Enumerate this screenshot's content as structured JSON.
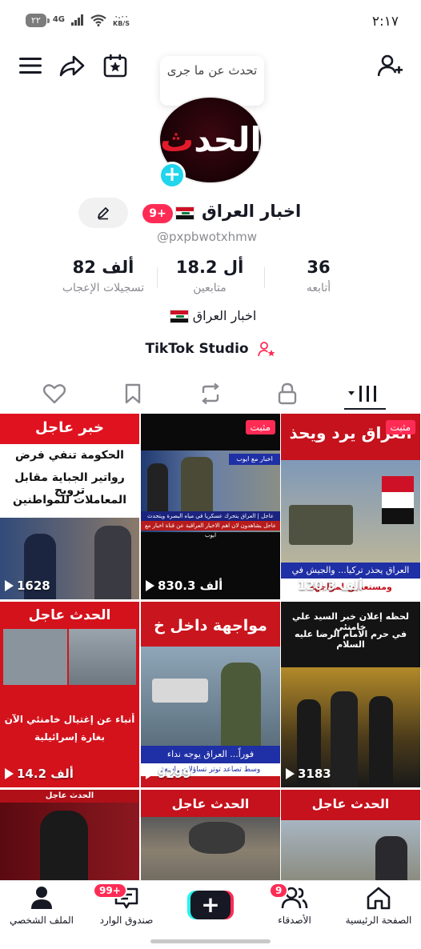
{
  "status_bar": {
    "time": "٢:١٧",
    "battery": "٢٢",
    "network": "4G",
    "speed_value": "٠.٠٠",
    "speed_unit": "KB/S"
  },
  "top_bar": {
    "tooltip": "تحدث عن ما جرى",
    "icons": [
      "menu-icon",
      "share-icon",
      "calendar-star-icon",
      "add-friend-icon"
    ]
  },
  "profile": {
    "avatar_logo_prefix": "الحد",
    "avatar_logo_suffix": "ث",
    "display_name": "اخبار العراق",
    "handle": "@pxpbwotxhmw",
    "badge": "9+",
    "edit_icon": "pencil-icon",
    "stats": [
      {
        "value": "36",
        "label": "أتابعه"
      },
      {
        "value": "18.2 أل",
        "label": "متابعين"
      },
      {
        "value": "82 ألف",
        "label": "تسجيلات الإعجاب"
      }
    ],
    "bio": "اخبار العراق",
    "studio": "TikTok Studio"
  },
  "tabs": [
    {
      "name": "videos",
      "icon": "grid-icon",
      "active": true
    },
    {
      "name": "private",
      "icon": "lock-icon",
      "active": false
    },
    {
      "name": "reposts",
      "icon": "repost-icon",
      "active": false
    },
    {
      "name": "favorites",
      "icon": "bookmark-icon",
      "active": false
    },
    {
      "name": "liked",
      "icon": "heart-icon",
      "active": false
    }
  ],
  "videos": [
    {
      "views": "120.3 ألف",
      "pinned": "مثبت",
      "headline": "العراق يرد ويحذ",
      "caption": "العراق يحذر تركيا... والجيش في",
      "subcaption": "ومستعدين لمواجهة"
    },
    {
      "views": "830.3 ألف",
      "pinned": "مثبت",
      "ticker_top": "اخبار مع ايوب",
      "ticker1": "عاجل | العراق يتحرك عسكريا في مياه البصرة ويتحدث الكويتية",
      "ticker2": "عاجل يشاهدون لان اهم الاخبار العراقية عن قناة اخبار مع ايوب"
    },
    {
      "views": "1628",
      "banner": "خبر عاجل",
      "caption": "الحكومة تنفي فرض",
      "caption2": "رواتير الجباية مقابل ترويج",
      "caption3": "المعاملات للمواطنين"
    },
    {
      "views": "3183",
      "caption": "لحظه إعلان خبر السيد علي خامنئي",
      "caption2": "في حرم الامام الرضا عليه السلام"
    },
    {
      "views": "9299",
      "banner": "مواجهة داخل خ",
      "caption": "فوراً... العراق يوجه نداء",
      "caption2": "وسط تصاعد توتر تساؤلات واسعة"
    },
    {
      "views": "14.2 ألف",
      "banner": "الحدث عاجل",
      "caption": "أنباء عن إغتيال خامنئي الآن",
      "caption2": "بغارة إسرائيلية"
    },
    {
      "banner": "الحدث عاجل"
    },
    {
      "banner": "الحدث عاجل"
    },
    {
      "banner": "الحدث عاجل"
    }
  ],
  "bottom_nav": [
    {
      "label": "الصفحة الرئيسية",
      "icon": "home-icon"
    },
    {
      "label": "الأصدقاء",
      "icon": "friends-icon",
      "badge": "9"
    },
    {
      "label": "",
      "icon": "plus-icon"
    },
    {
      "label": "صندوق الوارد",
      "icon": "inbox-icon",
      "badge": "99+"
    },
    {
      "label": "الملف الشخصي",
      "icon": "profile-icon"
    }
  ],
  "colors": {
    "accent": "#fe2c55",
    "cyan": "#20d5ec",
    "text": "#161823",
    "muted": "#8a8b91"
  }
}
